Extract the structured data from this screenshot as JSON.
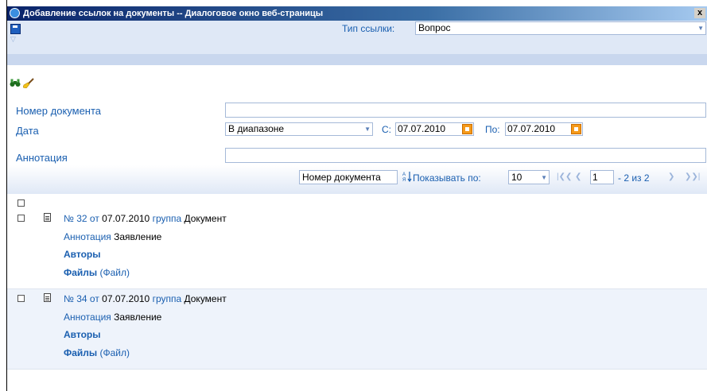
{
  "window": {
    "title": "Добавление ссылок на документы -- Диалоговое окно веб-страницы",
    "close": "x"
  },
  "link_type": {
    "label": "Тип ссылки:",
    "value": "Вопрос"
  },
  "form": {
    "doc_number_label": "Номер документа",
    "date_label": "Дата",
    "date_mode": "В диапазоне",
    "from_label": "С:",
    "from_value": "07.07.2010",
    "to_label": "По:",
    "to_value": "07.07.2010",
    "annotation_label": "Аннотация"
  },
  "pager": {
    "sort_field": "Номер документа",
    "show_label": "Показывать по:",
    "page_size": "10",
    "page": "1",
    "total": "- 2 из 2"
  },
  "items": [
    {
      "number": "№ 32",
      "from_word": "от",
      "date": "07.07.2010",
      "group_word": "группа",
      "group": "Документ",
      "annotation_label": "Аннотация",
      "annotation": "Заявление",
      "authors": "Авторы",
      "files_label": "Файлы",
      "files_value": "(Файл)"
    },
    {
      "number": "№ 34",
      "from_word": "от",
      "date": "07.07.2010",
      "group_word": "группа",
      "group": "Документ",
      "annotation_label": "Аннотация",
      "annotation": "Заявление",
      "authors": "Авторы",
      "files_label": "Файлы",
      "files_value": "(Файл)"
    }
  ]
}
